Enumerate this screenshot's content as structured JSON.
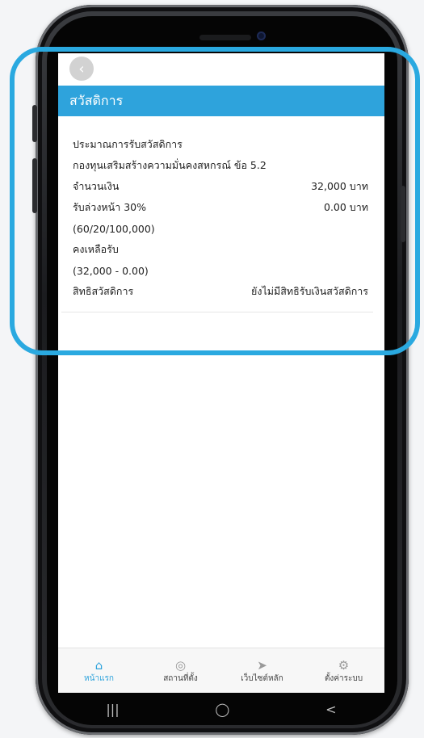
{
  "screen": {
    "back_icon": "chevron-left-icon",
    "title": "สวัสดิการ"
  },
  "welfare": {
    "rows": [
      {
        "label": "ประมาณการรับสวัสดิการ",
        "value": ""
      },
      {
        "label": "กองทุนเสริมสร้างความมั่นคงสหกรณ์ ข้อ 5.2",
        "value": ""
      },
      {
        "label": "จำนวนเงิน",
        "value": "32,000 บาท"
      },
      {
        "label": "รับล่วงหน้า 30%",
        "value": "0.00 บาท"
      },
      {
        "label": "(60/20/100,000)",
        "value": ""
      },
      {
        "label": "คงเหลือรับ",
        "value": ""
      },
      {
        "label": "(32,000 - 0.00)",
        "value": ""
      },
      {
        "label": "สิทธิสวัสดิการ",
        "value": "ยังไม่มีสิทธิรับเงินสวัสดิการ"
      }
    ]
  },
  "bottom_nav": {
    "items": [
      {
        "label": "หน้าแรก",
        "icon": "home-icon",
        "active": true
      },
      {
        "label": "สถานที่ตั้ง",
        "icon": "compass-icon",
        "active": false
      },
      {
        "label": "เว็บไซต์หลัก",
        "icon": "navigation-icon",
        "active": false
      },
      {
        "label": "ตั้งค่าระบบ",
        "icon": "gear-icon",
        "active": false
      }
    ]
  },
  "system_nav": {
    "recents_glyph": "|||",
    "home_glyph": "◯",
    "back_glyph": "<"
  },
  "colors": {
    "accent": "#2ea3dc",
    "highlight": "#2aa9e0",
    "back_button": "#d2d2d2"
  }
}
